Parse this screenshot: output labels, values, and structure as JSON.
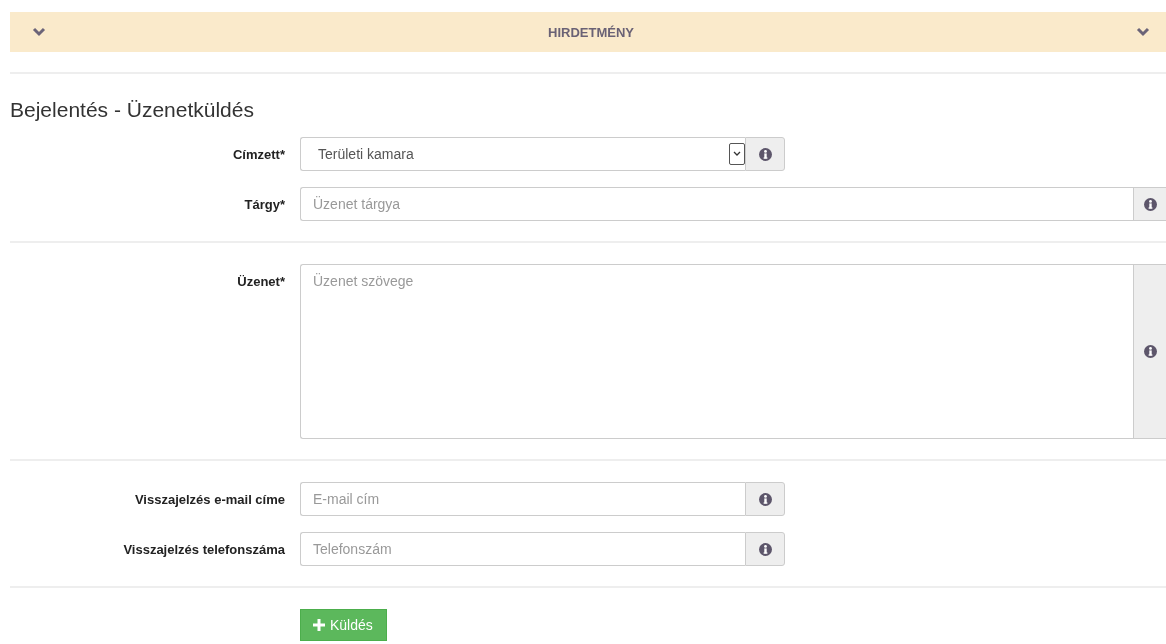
{
  "banner": {
    "title": "HIRDETMÉNY"
  },
  "heading": "Bejelentés - Üzenetküldés",
  "sections": [
    {
      "rows": [
        {
          "kind": "select",
          "label": "Címzett*",
          "value": "Területi kamara"
        },
        {
          "kind": "text",
          "label": "Tárgy*",
          "placeholder": "Üzenet tárgya"
        }
      ]
    },
    {
      "rows": [
        {
          "kind": "textarea",
          "label": "Üzenet*",
          "placeholder": "Üzenet szövege"
        }
      ]
    },
    {
      "rows": [
        {
          "kind": "shorttext",
          "label": "Visszajelzés e-mail címe",
          "placeholder": "E-mail cím"
        },
        {
          "kind": "shorttext",
          "label": "Visszajelzés telefonszáma",
          "placeholder": "Telefonszám"
        }
      ]
    }
  ],
  "submit": {
    "label": "Küldés"
  }
}
